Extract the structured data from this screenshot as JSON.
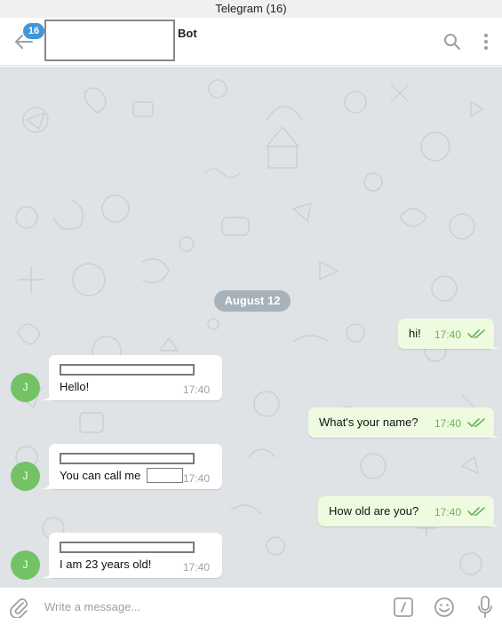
{
  "window": {
    "title": "Telegram (16)"
  },
  "header": {
    "unread_count": "16",
    "chat_title": "Bot",
    "icons": {
      "back": "arrow-left-icon",
      "search": "search-icon",
      "menu": "more-vertical-icon"
    }
  },
  "chat": {
    "date_separator": "August 12",
    "messages": [
      {
        "direction": "outgoing",
        "text": "hi!",
        "time": "17:40",
        "status": "read"
      },
      {
        "direction": "incoming",
        "avatar": "J",
        "text": "Hello!",
        "time": "17:40"
      },
      {
        "direction": "outgoing",
        "text": "What's your name?",
        "time": "17:40",
        "status": "read"
      },
      {
        "direction": "incoming",
        "avatar": "J",
        "text": "You can call me",
        "time": "17:40"
      },
      {
        "direction": "outgoing",
        "text": "How old are you?",
        "time": "17:40",
        "status": "read"
      },
      {
        "direction": "incoming",
        "avatar": "J",
        "text": "I am 23 years old!",
        "time": "17:40"
      }
    ]
  },
  "composer": {
    "placeholder": "Write a message...",
    "icons": {
      "attach": "paperclip-icon",
      "commands": "slash-command-icon",
      "emoji": "emoji-icon",
      "voice": "microphone-icon"
    }
  },
  "colors": {
    "accent": "#3f96d8",
    "outgoing_bubble": "#eefbe0",
    "incoming_bubble": "#ffffff",
    "chat_background": "#dfe3e6",
    "avatar": "#73c366",
    "read_check": "#6bb35a"
  }
}
